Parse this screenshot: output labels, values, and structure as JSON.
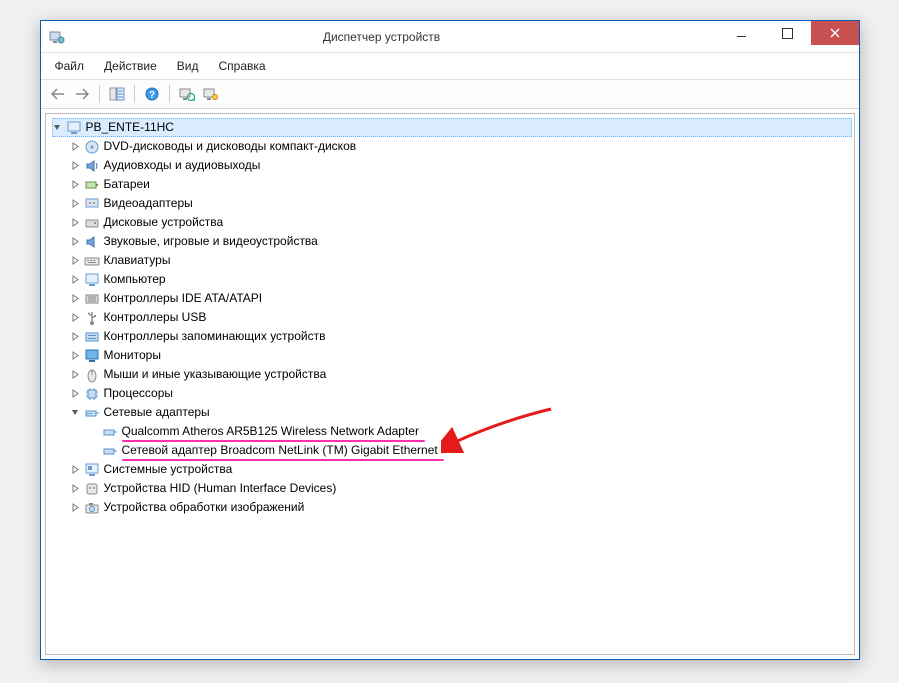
{
  "window": {
    "title": "Диспетчер устройств"
  },
  "menu": {
    "file": "Файл",
    "action": "Действие",
    "view": "Вид",
    "help": "Справка"
  },
  "tree": {
    "root": "PB_ENTE-11HC",
    "items": {
      "dvd": "DVD-дисководы и дисководы компакт-дисков",
      "audio": "Аудиовходы и аудиовыходы",
      "battery": "Батареи",
      "video": "Видеоадаптеры",
      "disk": "Дисковые устройства",
      "sound": "Звуковые, игровые и видеоустройства",
      "keyboard": "Клавиатуры",
      "computer": "Компьютер",
      "ide": "Контроллеры IDE ATA/ATAPI",
      "usb": "Контроллеры USB",
      "storage": "Контроллеры запоминающих устройств",
      "monitor": "Мониторы",
      "mouse": "Мыши и иные указывающие устройства",
      "cpu": "Процессоры",
      "network": "Сетевые адаптеры",
      "net_wifi": "Qualcomm Atheros AR5B125 Wireless Network Adapter",
      "net_eth": "Сетевой адаптер Broadcom NetLink (TM) Gigabit Ethernet",
      "system": "Системные устройства",
      "hid": "Устройства HID (Human Interface Devices)",
      "imaging": "Устройства обработки изображений"
    }
  }
}
